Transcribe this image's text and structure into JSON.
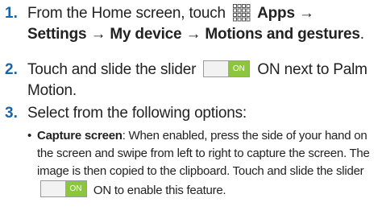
{
  "step1": {
    "number": "1.",
    "line1_lead": "From the Home screen, touch",
    "apps_label": "Apps",
    "line1_arrow": "→",
    "settings_label": "Settings",
    "line2_arrow": "→",
    "line2_path": "My device → Motions and gestures",
    "line2_end": "."
  },
  "step2": {
    "number": "2.",
    "lead": "Touch and slide the slider",
    "toggle_text": "ON",
    "tail": "ON next to Palm Motion."
  },
  "step3": {
    "number": "3.",
    "text": "Select from the following options:"
  },
  "bullet": {
    "dot": "•",
    "term": "Capture screen",
    "description": ": When enabled, press the side of your hand on the screen and swipe from left to right to capture the screen. The image is then copied to the clipboard. Touch and slide the slider",
    "toggle_text": "ON",
    "tail": "ON to enable this feature."
  },
  "colors": {
    "step_number": "#1a64a8",
    "toggle_on": "#8cc63f"
  },
  "icons": {
    "apps": "apps-grid-icon"
  }
}
